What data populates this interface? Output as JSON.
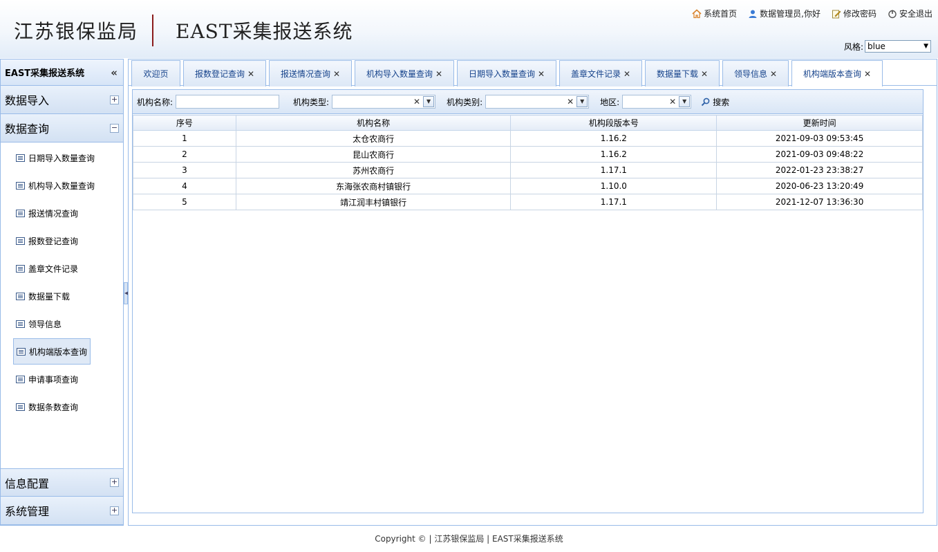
{
  "header": {
    "org": "江苏银保监局",
    "system": "EAST采集报送系统",
    "links": {
      "home": "系统首页",
      "user": "数据管理员,你好",
      "password": "修改密码",
      "logout": "安全退出"
    },
    "style_label": "风格:",
    "style_value": "blue"
  },
  "sidebar": {
    "title": "EAST采集报送系统",
    "collapse_glyph": "«",
    "sections": {
      "import": "数据导入",
      "query": "数据查询",
      "info": "信息配置",
      "system": "系统管理"
    },
    "items": [
      {
        "label": "日期导入数量查询"
      },
      {
        "label": "机构导入数量查询"
      },
      {
        "label": "报送情况查询"
      },
      {
        "label": "报数登记查询"
      },
      {
        "label": "盖章文件记录"
      },
      {
        "label": "数据量下载"
      },
      {
        "label": "领导信息"
      },
      {
        "label": "机构端版本查询"
      },
      {
        "label": "申请事项查询"
      },
      {
        "label": "数据条数查询"
      }
    ]
  },
  "tabs": [
    {
      "label": "欢迎页"
    },
    {
      "label": "报数登记查询"
    },
    {
      "label": "报送情况查询"
    },
    {
      "label": "机构导入数量查询"
    },
    {
      "label": "日期导入数量查询"
    },
    {
      "label": "盖章文件记录"
    },
    {
      "label": "数据量下载"
    },
    {
      "label": "领导信息"
    },
    {
      "label": "机构端版本查询"
    }
  ],
  "search": {
    "org_name_label": "机构名称:",
    "org_type_label": "机构类型:",
    "org_category_label": "机构类别:",
    "region_label": "地区:",
    "button_label": "搜索"
  },
  "table": {
    "columns": [
      "序号",
      "机构名称",
      "机构段版本号",
      "更新时间"
    ],
    "rows": [
      [
        "1",
        "太仓农商行",
        "1.16.2",
        "2021-09-03 09:53:45"
      ],
      [
        "2",
        "昆山农商行",
        "1.16.2",
        "2021-09-03 09:48:22"
      ],
      [
        "3",
        "苏州农商行",
        "1.17.1",
        "2022-01-23 23:38:27"
      ],
      [
        "4",
        "东海张农商村镇银行",
        "1.10.0",
        "2020-06-23 13:20:49"
      ],
      [
        "5",
        "靖江润丰村镇银行",
        "1.17.1",
        "2021-12-07 13:36:30"
      ]
    ]
  },
  "footer": "Copyright © | 江苏银保监局 | EAST采集报送系统"
}
